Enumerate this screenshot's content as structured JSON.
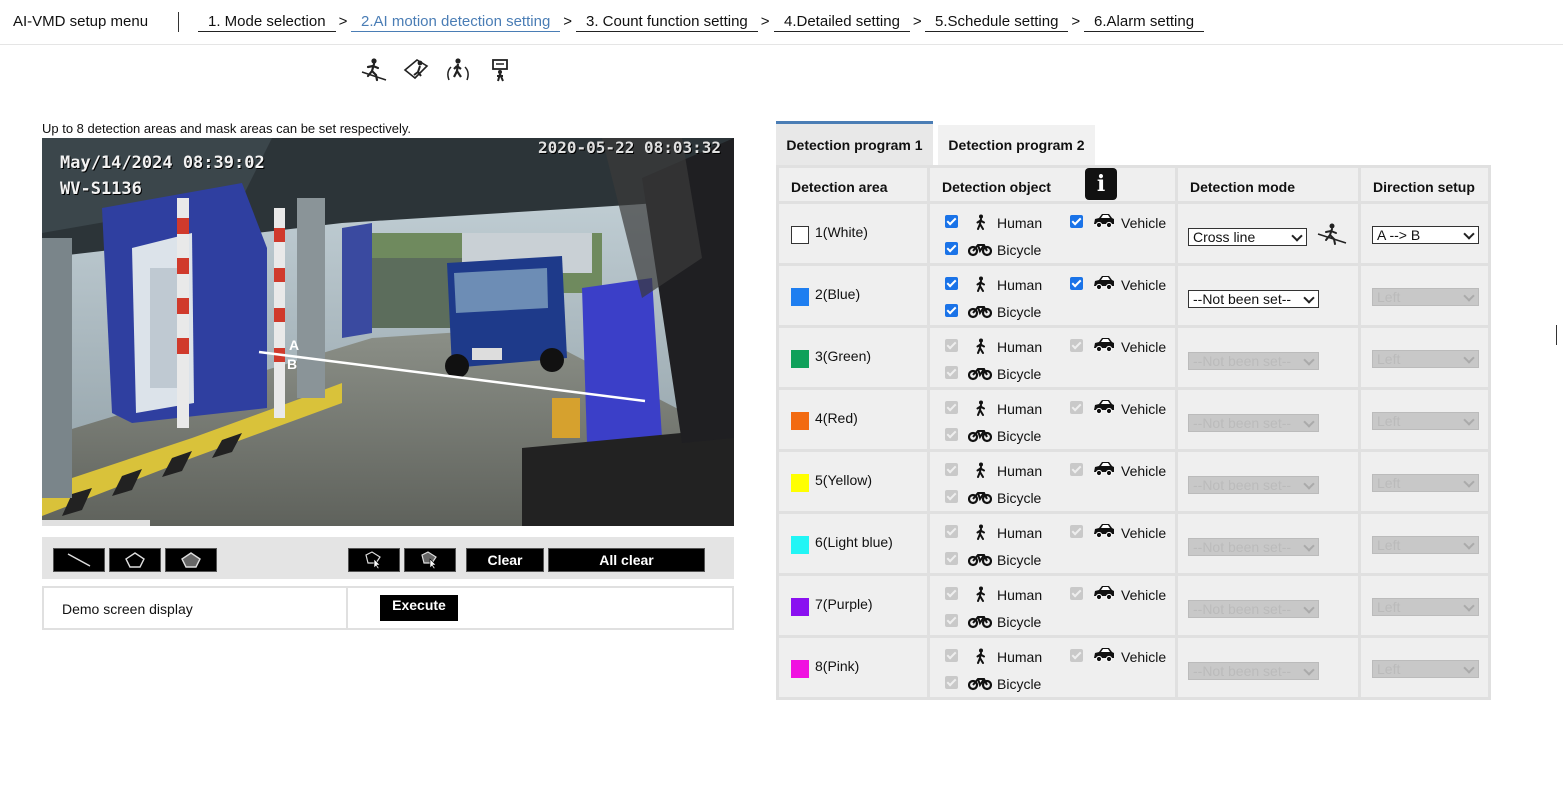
{
  "header": {
    "title": "AI-VMD setup menu",
    "breadcrumbs": [
      {
        "label": "1. Mode selection",
        "sep": ">"
      },
      {
        "label": "2.AI motion detection setting",
        "sep": ">"
      },
      {
        "label": "3. Count function setting",
        "sep": ">"
      },
      {
        "label": "4.Detailed setting",
        "sep": ">"
      },
      {
        "label": "5.Schedule setting",
        "sep": ">"
      },
      {
        "label": "6.Alarm setting",
        "sep": ""
      }
    ]
  },
  "mode_icons": [
    "cross-line-icon",
    "area-intrusion-icon",
    "loitering-icon",
    "stay-detection-icon"
  ],
  "note": "Up to 8 detection areas and mask areas can be set respectively.",
  "camera": {
    "timestamp_1": "May/14/2024 08:39:02",
    "camera_name": "WV-S1136",
    "timestamp_2": "2020-05-22 08:03:32",
    "line_label_a": "A",
    "line_label_b": "B"
  },
  "toolbar": {
    "tools": [
      "line-tool-icon",
      "polygon-tool-icon",
      "mask-polygon-tool-icon",
      "select-cursor-icon",
      "move-cursor-icon"
    ],
    "clear_label": "Clear",
    "all_clear_label": "All clear"
  },
  "demo": {
    "label": "Demo screen display",
    "execute_label": "Execute"
  },
  "tabs": [
    {
      "label": "Detection program 1",
      "active": true
    },
    {
      "label": "Detection program 2",
      "active": false
    }
  ],
  "table": {
    "headers": [
      "Detection area",
      "Detection object",
      "Detection mode",
      "Direction setup"
    ],
    "object_labels": {
      "human": "Human",
      "vehicle": "Vehicle",
      "bicycle": "Bicycle"
    },
    "rows": [
      {
        "area": "1(White)",
        "color": "#ffffff",
        "enabled": true,
        "mode": "Cross line",
        "direction": "A --> B"
      },
      {
        "area": "2(Blue)",
        "color": "#1e7ef0",
        "enabled": true,
        "mode": "--Not been set--",
        "direction": "Left"
      },
      {
        "area": "3(Green)",
        "color": "#0fa05a",
        "enabled": false,
        "mode": "--Not been set--",
        "direction": "Left"
      },
      {
        "area": "4(Red)",
        "color": "#f26a10",
        "enabled": false,
        "mode": "--Not been set--",
        "direction": "Left"
      },
      {
        "area": "5(Yellow)",
        "color": "#ffff00",
        "enabled": false,
        "mode": "--Not been set--",
        "direction": "Left"
      },
      {
        "area": "6(Light blue)",
        "color": "#22f5f5",
        "enabled": false,
        "mode": "--Not been set--",
        "direction": "Left"
      },
      {
        "area": "7(Purple)",
        "color": "#8a10f0",
        "enabled": false,
        "mode": "--Not been set--",
        "direction": "Left"
      },
      {
        "area": "8(Pink)",
        "color": "#f010e0",
        "enabled": false,
        "mode": "--Not been set--",
        "direction": "Left"
      }
    ]
  }
}
